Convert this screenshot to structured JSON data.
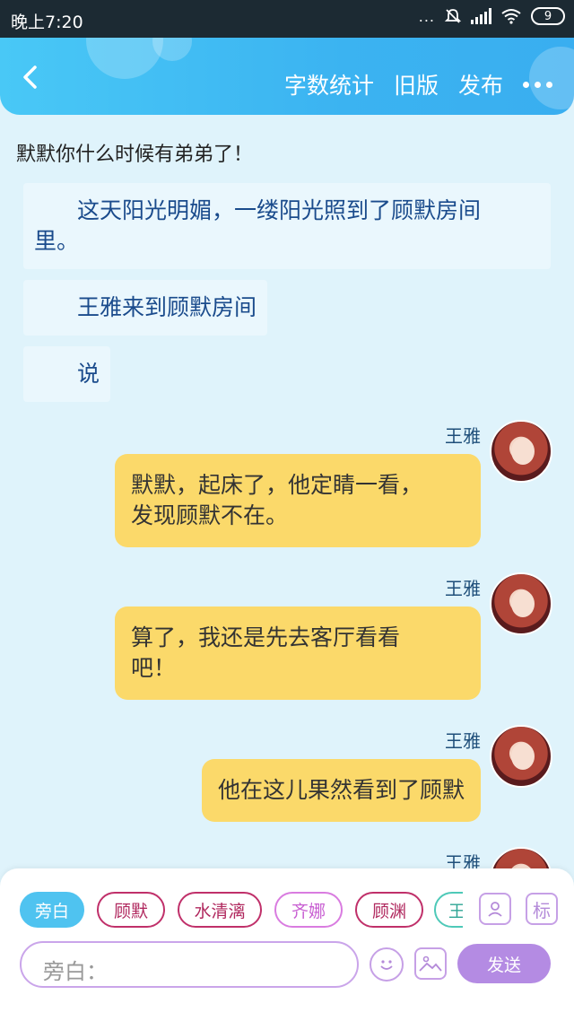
{
  "status_bar": {
    "time": "晚上7:20",
    "more": "...",
    "battery": "9"
  },
  "header": {
    "back_icon": "chevron-left-icon",
    "word_count": "字数统计",
    "old_version": "旧版",
    "publish": "发布",
    "more_icon": "more-dots-icon",
    "accent_color": "#3bb3f1"
  },
  "chat": {
    "top_note": "默默你什么时候有弟弟了！",
    "narrations": [
      {
        "line1": "这天阳光明媚，一缕阳光照到了顾默房间",
        "line2": "里。"
      },
      {
        "line1": "王雅来到顾默房间"
      },
      {
        "line1": "说"
      }
    ],
    "messages": [
      {
        "speaker": "王雅",
        "line1": "默默，起床了，他定睛一看，",
        "line2": "发现顾默不在。"
      },
      {
        "speaker": "王雅",
        "line1": "算了，我还是先去客厅看看",
        "line2": "吧！"
      },
      {
        "speaker": "王雅",
        "line1": "他在这儿果然看到了顾默"
      },
      {
        "speaker": "王雅"
      }
    ]
  },
  "composer": {
    "roles": [
      "旁白",
      "顾默",
      "水清漓",
      "齐娜",
      "顾渊",
      "王"
    ],
    "active_role": "旁白",
    "profile_icon": "character-card-icon",
    "tag_label": "标",
    "input_placeholder": "旁白：",
    "emoji_icon": "emoji-icon",
    "image_icon": "image-icon",
    "send_label": "发送"
  }
}
